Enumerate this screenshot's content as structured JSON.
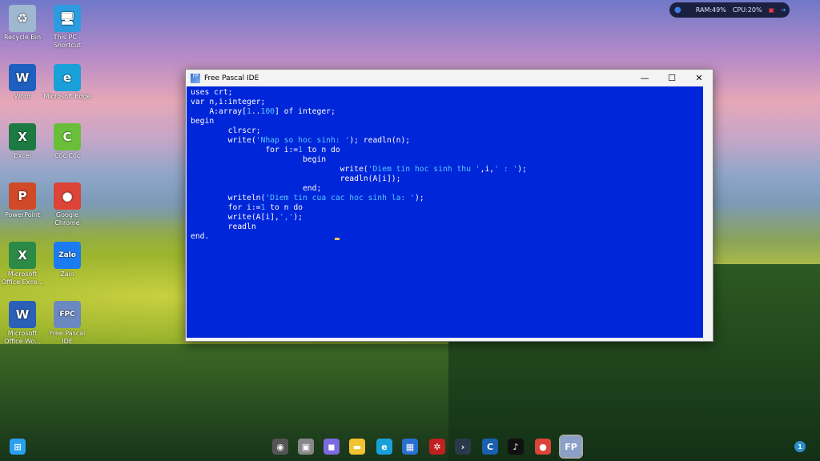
{
  "desktop_icons": [
    {
      "label": "Recycle Bin",
      "glyph": "♻",
      "color": "#9fb7d0"
    },
    {
      "label": "This PC - Shortcut",
      "glyph": "🖥",
      "color": "#2d9be0"
    },
    {
      "label": "Word",
      "glyph": "W",
      "color": "#1e5fbf"
    },
    {
      "label": "Microsoft Edge",
      "glyph": "e",
      "color": "#1aa0d8"
    },
    {
      "label": "Excel",
      "glyph": "X",
      "color": "#1d7a43"
    },
    {
      "label": "Cốc Cốc",
      "glyph": "C",
      "color": "#6abf3a"
    },
    {
      "label": "PowerPoint",
      "glyph": "P",
      "color": "#d04a28"
    },
    {
      "label": "Google Chrome",
      "glyph": "●",
      "color": "#db4437"
    },
    {
      "label": "Microsoft Office Exce...",
      "glyph": "X",
      "color": "#2c8a47"
    },
    {
      "label": "Zalo",
      "glyph": "Zalo",
      "color": "#1a7cf0"
    },
    {
      "label": "Microsoft Office Wo...",
      "glyph": "W",
      "color": "#2b5fb8"
    },
    {
      "label": "Free Pascal IDE",
      "glyph": "FPC",
      "color": "#6b88c0"
    }
  ],
  "window": {
    "title": "Free Pascal IDE",
    "minimize": "—",
    "maximize": "☐",
    "close": "✕"
  },
  "code": [
    [
      [
        "k",
        "uses crt;"
      ]
    ],
    [
      [
        "k",
        "var n,i:integer;"
      ]
    ],
    [
      [
        "k",
        "    A:array["
      ],
      [
        "s",
        "1"
      ],
      [
        "k",
        ".."
      ],
      [
        "s",
        "100"
      ],
      [
        "k",
        "] of integer;"
      ]
    ],
    [
      [
        "k",
        "begin"
      ]
    ],
    [
      [
        "k",
        "        clrscr;"
      ]
    ],
    [
      [
        "k",
        "        write("
      ],
      [
        "s",
        "'Nhap so hoc sinh: '"
      ],
      [
        "k",
        "); readln(n);"
      ]
    ],
    [
      [
        "k",
        "                for i:="
      ],
      [
        "s",
        "1"
      ],
      [
        "k",
        " to n do"
      ]
    ],
    [
      [
        "k",
        "                        begin"
      ]
    ],
    [
      [
        "k",
        "                                write("
      ],
      [
        "s",
        "'Diem tin hoc sinh thu '"
      ],
      [
        "k",
        ",i,"
      ],
      [
        "s",
        "' : '"
      ],
      [
        "k",
        ");"
      ]
    ],
    [
      [
        "k",
        "                                readln(A[i]);"
      ]
    ],
    [
      [
        "k",
        "                        end;"
      ]
    ],
    [
      [
        "k",
        "        writeln("
      ],
      [
        "s",
        "'Diem tin cua cac hoc sinh la: '"
      ],
      [
        "k",
        ");"
      ]
    ],
    [
      [
        "k",
        "        for i:="
      ],
      [
        "s",
        "1"
      ],
      [
        "k",
        " to n do"
      ]
    ],
    [
      [
        "k",
        "        write(A[i],"
      ],
      [
        "s",
        "','"
      ],
      [
        "k",
        ");"
      ]
    ],
    [
      [
        "k",
        "        readln"
      ]
    ],
    [
      [
        "k",
        "end."
      ]
    ]
  ],
  "widget": {
    "ram": "RAM:49%",
    "cpu": "CPU:20%"
  },
  "taskbar": {
    "apps": [
      {
        "name": "start",
        "glyph": "⊞",
        "color": "#2aa0f0"
      },
      {
        "name": "search",
        "glyph": "◉",
        "color": "#555"
      },
      {
        "name": "task-view",
        "glyph": "▣",
        "color": "#888"
      },
      {
        "name": "teams",
        "glyph": "◼",
        "color": "#7b6ae0"
      },
      {
        "name": "file-explorer",
        "glyph": "▬",
        "color": "#f2c230"
      },
      {
        "name": "edge",
        "glyph": "e",
        "color": "#1aa0d8"
      },
      {
        "name": "store",
        "glyph": "▦",
        "color": "#2a6fd0"
      },
      {
        "name": "app-red",
        "glyph": "✲",
        "color": "#c02020"
      },
      {
        "name": "terminal",
        "glyph": "›",
        "color": "#2a3a4a"
      },
      {
        "name": "ccleaner",
        "glyph": "C",
        "color": "#1a5fb0"
      },
      {
        "name": "tiktok",
        "glyph": "♪",
        "color": "#111"
      },
      {
        "name": "chrome",
        "glyph": "●",
        "color": "#db4437"
      },
      {
        "name": "free-pascal",
        "glyph": "FP",
        "color": "#8aa0c8"
      }
    ],
    "notification_count": "1"
  }
}
